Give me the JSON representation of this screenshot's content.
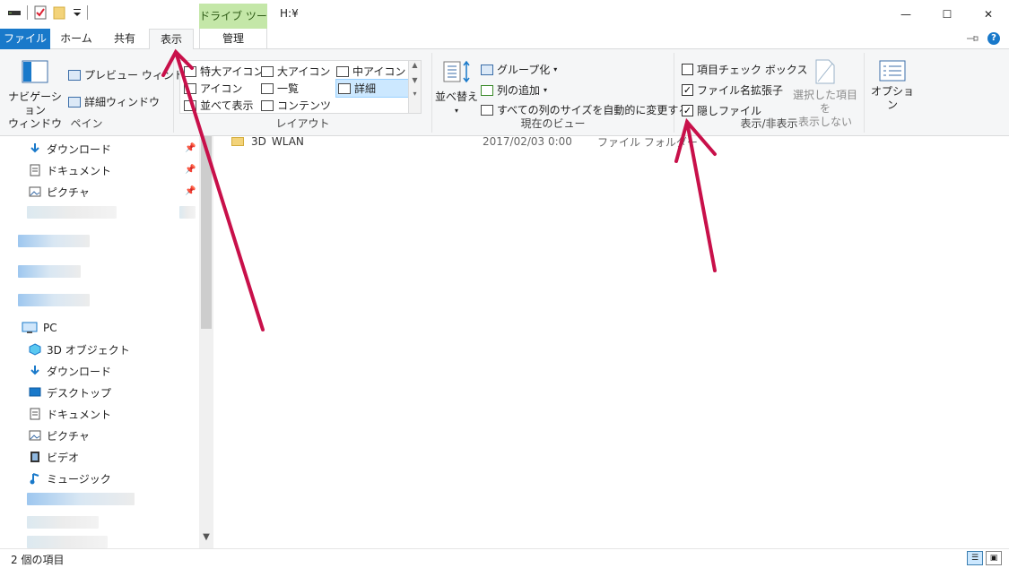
{
  "window": {
    "title": "H:¥",
    "context_tab": "ドライブ ツール",
    "minimize": "—",
    "maximize": "☐",
    "close": "✕"
  },
  "tabs": {
    "file": "ファイル",
    "home": "ホーム",
    "share": "共有",
    "view": "表示",
    "manage": "管理"
  },
  "ribbon": {
    "pane": {
      "navigation_pane": "ナビゲーション\nウィンドウ",
      "preview_pane": "プレビュー ウィンドウ",
      "details_pane": "詳細ウィンドウ",
      "label": "ペイン"
    },
    "layout": {
      "extra_large_icons": "特大アイコン",
      "large_icons": "大アイコン",
      "medium_icons": "中アイコン",
      "small_icons": "アイコン",
      "list": "一覧",
      "details": "詳細",
      "tiles": "並べて表示",
      "content": "コンテンツ",
      "label": "レイアウト"
    },
    "current_view": {
      "sort_by": "並べ替え",
      "group_by": "グループ化",
      "add_columns": "列の追加",
      "size_all_columns": "すべての列のサイズを自動的に変更する",
      "label": "現在のビュー"
    },
    "show_hide": {
      "item_checkboxes": "項目チェック ボックス",
      "file_name_extensions": "ファイル名拡張子",
      "hidden_items": "隠しファイル",
      "hide_selected": "選択した項目を\n表示しない",
      "label": "表示/非表示",
      "item_checkboxes_checked": false,
      "file_name_extensions_checked": true,
      "hidden_items_checked": true
    },
    "options": "オプション"
  },
  "nav": {
    "quick_access": [
      "ダウンロード",
      "ドキュメント",
      "ピクチャ"
    ],
    "pc": "PC",
    "pc_items": [
      "3D オブジェクト",
      "ダウンロード",
      "デスクトップ",
      "ドキュメント",
      "ピクチャ",
      "ビデオ",
      "ミュージック"
    ]
  },
  "content": {
    "rows": [
      {
        "name": "3D_WLAN",
        "date": "2017/02/03 0:00",
        "type": "ファイル フォルダー"
      }
    ]
  },
  "status": {
    "item_count": "2 個の項目"
  },
  "colors": {
    "accent": "#1979ca",
    "context_tab": "#c4e7a8",
    "annotation_arrow": "#c8104a"
  }
}
